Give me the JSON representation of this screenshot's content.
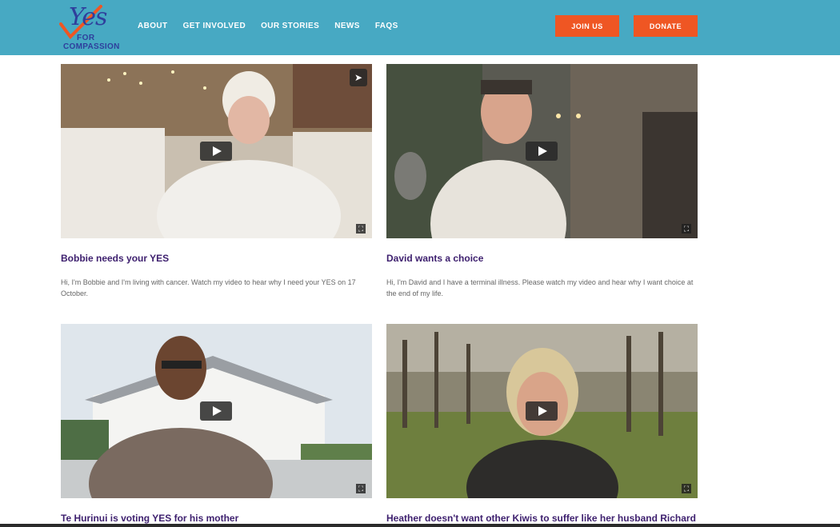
{
  "header": {
    "logo": {
      "yes": "Yes",
      "for": "FOR",
      "compassion": "COMPASSION"
    },
    "nav": [
      "ABOUT",
      "GET INVOLVED",
      "OUR STORIES",
      "NEWS",
      "FAQS"
    ],
    "join_label": "JOIN US",
    "donate_label": "DONATE",
    "accent_color": "#47a9c3",
    "button_color": "#ef5623"
  },
  "stories": [
    {
      "title": "Bobbie needs your YES",
      "description": "Hi, I'm Bobbie and I'm living with cancer. Watch my video to hear why I need your YES on 17 October."
    },
    {
      "title": "David wants a choice",
      "description": "Hi, I'm David and I have a terminal illness. Please watch my video and hear why I want choice at the end of my life."
    },
    {
      "title": "Te Hurinui is voting YES for his mother",
      "description": ""
    },
    {
      "title": "Heather doesn't want other Kiwis to suffer like her husband Richard",
      "description": ""
    }
  ],
  "icons": {
    "play": "play-icon",
    "fullscreen": "fullscreen-icon",
    "share": "share-icon"
  }
}
